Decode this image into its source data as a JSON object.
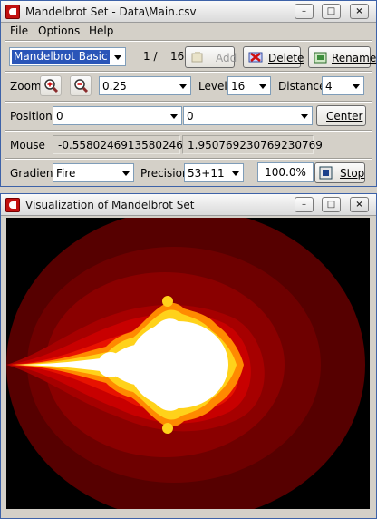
{
  "main_window": {
    "title": "Mandelbrot Set -  Data\\Main.csv",
    "controls": {
      "minimize": "–",
      "maximize": "□",
      "close": "×"
    }
  },
  "menu": [
    "File",
    "Options",
    "Help"
  ],
  "preset": {
    "selected": "Mandelbrot Basic",
    "index_label": "1 /",
    "total": "16",
    "add_label": "Add",
    "delete_label": "Delete",
    "rename_label": "Rename"
  },
  "zoom": {
    "label": "Zoom",
    "value": "0.25",
    "level_label": "Level",
    "level_value": "16",
    "distance_label": "Distance",
    "distance_value": "4"
  },
  "position": {
    "label": "Position",
    "x": "0",
    "y": "0",
    "center_label": "Center"
  },
  "mouse": {
    "label": "Mouse",
    "x": "-0.55802469135802469",
    "y": "1.950769230769230769"
  },
  "gradient": {
    "label": "Gradient",
    "value": "Fire",
    "precision_label": "Precision",
    "precision_value": "53+11",
    "zoom_percent": "100.0%",
    "stop_label": "Stop"
  },
  "viz_window": {
    "title": "Visualization of Mandelbrot Set",
    "controls": {
      "minimize": "–",
      "maximize": "□",
      "close": "×"
    }
  },
  "colors": {
    "title_border": "#3d62a8",
    "selection": "#2a55b8",
    "fractal_outer": "#5c0000",
    "fractal_mid": "#d40000",
    "fractal_edge": "#ffd21a",
    "fractal_core": "#ffffff"
  },
  "icons": {
    "zoom_in": "magnifier-plus-icon",
    "zoom_out": "magnifier-minus-icon",
    "add": "add-icon",
    "delete": "delete-icon",
    "rename": "rename-icon",
    "stop": "stop-icon",
    "app": "app-icon"
  }
}
